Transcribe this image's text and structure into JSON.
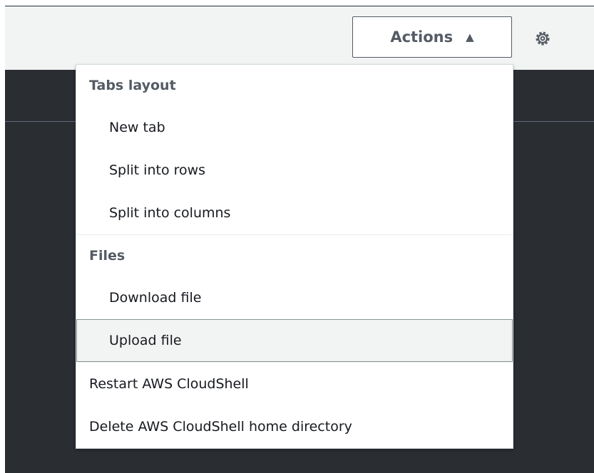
{
  "header": {
    "actions_label": "Actions",
    "actions_caret": "▲",
    "settings_icon": "gear-icon"
  },
  "menu": {
    "groups": [
      {
        "label": "Tabs layout",
        "items": [
          "New tab",
          "Split into rows",
          "Split into columns"
        ]
      },
      {
        "label": "Files",
        "items": [
          "Download file",
          "Upload file"
        ]
      }
    ],
    "top_items": [
      "Restart AWS CloudShell",
      "Delete AWS CloudShell home directory"
    ],
    "highlighted_item": "Upload file"
  },
  "colors": {
    "toolbar_bg": "#f2f3f3",
    "terminal_bg": "#2a2e33",
    "button_border": "#545b64",
    "highlight_bg": "#f2f3f3"
  }
}
